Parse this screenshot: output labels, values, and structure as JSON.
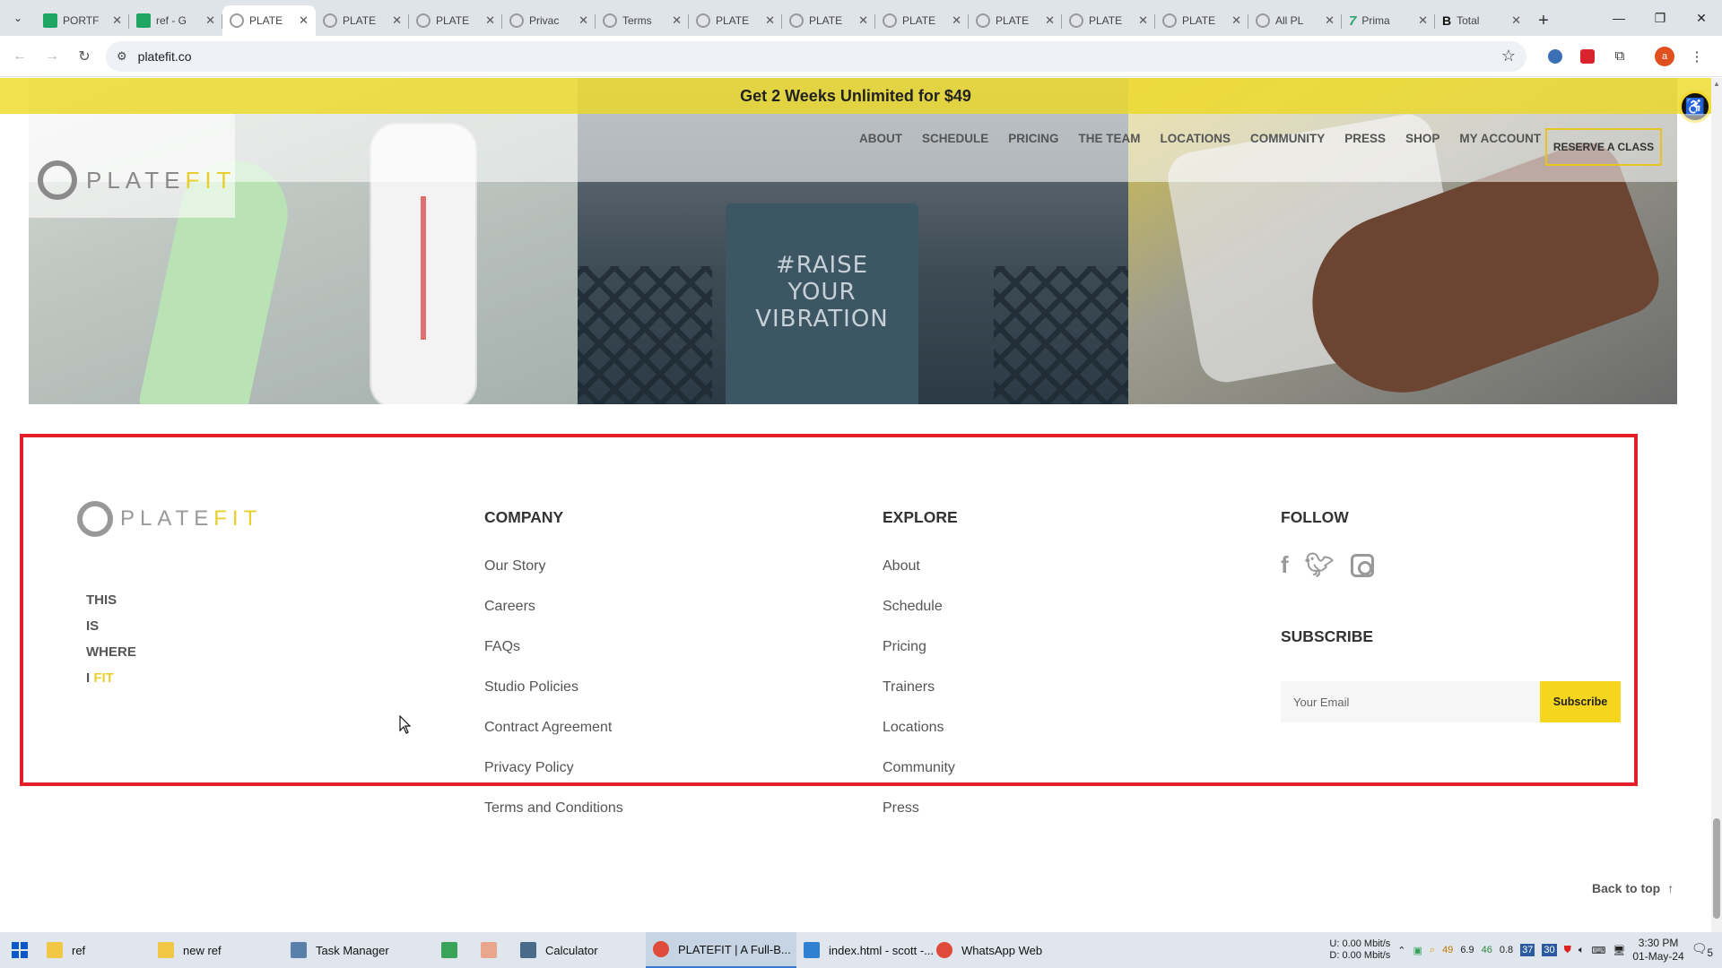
{
  "browser": {
    "tabs": [
      {
        "title": "PORTF",
        "fav": "sheet",
        "active": false
      },
      {
        "title": "ref - G",
        "fav": "sheet",
        "active": false
      },
      {
        "title": "PLATE",
        "fav": "ring",
        "active": true
      },
      {
        "title": "PLATE",
        "fav": "ring",
        "active": false
      },
      {
        "title": "PLATE",
        "fav": "ring",
        "active": false
      },
      {
        "title": "Privac",
        "fav": "ring",
        "active": false
      },
      {
        "title": "Terms",
        "fav": "ring",
        "active": false
      },
      {
        "title": "PLATE",
        "fav": "ring",
        "active": false
      },
      {
        "title": "PLATE",
        "fav": "ring",
        "active": false
      },
      {
        "title": "PLATE",
        "fav": "ring",
        "active": false
      },
      {
        "title": "PLATE",
        "fav": "ring",
        "active": false
      },
      {
        "title": "PLATE",
        "fav": "ring",
        "active": false
      },
      {
        "title": "PLATE",
        "fav": "ring",
        "active": false
      },
      {
        "title": "All PL",
        "fav": "ring",
        "active": false
      },
      {
        "title": "Prima",
        "fav": "seven",
        "active": false
      },
      {
        "title": "Total",
        "fav": "bold",
        "active": false
      }
    ],
    "tab_close": "✕",
    "new_tab": "+",
    "url": "platefit.co",
    "profile_initial": "a"
  },
  "site": {
    "promo": "Get 2 Weeks Unlimited for $49",
    "logo_word_plate": "PLATE",
    "logo_word_fit": "FIT",
    "nav": [
      "ABOUT",
      "SCHEDULE",
      "PRICING",
      "THE TEAM",
      "LOCATIONS",
      "COMMUNITY",
      "PRESS",
      "SHOP",
      "MY ACCOUNT"
    ],
    "reserve": "RESERVE A CLASS",
    "sign_lines": [
      "#RAISE",
      "YOUR",
      "VIBRATION"
    ]
  },
  "footer": {
    "logo_word_plate": "PLATE",
    "logo_word_fit": "FIT",
    "tagline": [
      "THIS",
      "IS",
      "WHERE"
    ],
    "tagline_last_prefix": "I",
    "tagline_last_fit": "FIT",
    "company": {
      "title": "COMPANY",
      "links": [
        "Our Story",
        "Careers",
        "FAQs",
        "Studio Policies",
        "Contract Agreement",
        "Privacy Policy",
        "Terms and Conditions"
      ]
    },
    "explore": {
      "title": "EXPLORE",
      "links": [
        "About",
        "Schedule",
        "Pricing",
        "Trainers",
        "Locations",
        "Community",
        "Press"
      ]
    },
    "follow": {
      "title": "FOLLOW",
      "icons": [
        "facebook-icon",
        "twitter-icon",
        "instagram-icon"
      ]
    },
    "subscribe": {
      "title": "SUBSCRIBE",
      "placeholder": "Your Email",
      "button": "Subscribe"
    },
    "back_to_top": "Back to top"
  },
  "taskbar": {
    "items": [
      {
        "label": "ref",
        "icon": "folder-icon",
        "color": "#f2c744",
        "active": false
      },
      {
        "label": "new ref",
        "icon": "folder-icon",
        "color": "#f2c744",
        "active": false
      },
      {
        "label": "Task Manager",
        "icon": "task-manager-icon",
        "color": "#5a7fa8",
        "active": false
      },
      {
        "label": "",
        "icon": "spreadsheet-icon",
        "color": "#3aa35a",
        "active": false
      },
      {
        "label": "",
        "icon": "app-icon",
        "color": "#e9a68a",
        "active": false
      },
      {
        "label": "Calculator",
        "icon": "calculator-icon",
        "color": "#4a6a8a",
        "active": false
      },
      {
        "label": "PLATEFIT | A Full-B...",
        "icon": "chrome-icon",
        "color": "#e04a3a",
        "active": true
      },
      {
        "label": "index.html - scott -...",
        "icon": "vscode-icon",
        "color": "#2f80d0",
        "active": false
      },
      {
        "label": "WhatsApp Web",
        "icon": "chrome-icon",
        "color": "#e04a3a",
        "active": false
      }
    ],
    "net_up": "0.00 Mbit/s",
    "net_down": "0.00 Mbit/s",
    "net_up_label": "U:",
    "net_down_label": "D:",
    "tray_values": [
      "49",
      "6.9",
      "46",
      "0.8"
    ],
    "time": "3:30 PM",
    "date": "01-May-24",
    "notification_count": "5"
  }
}
